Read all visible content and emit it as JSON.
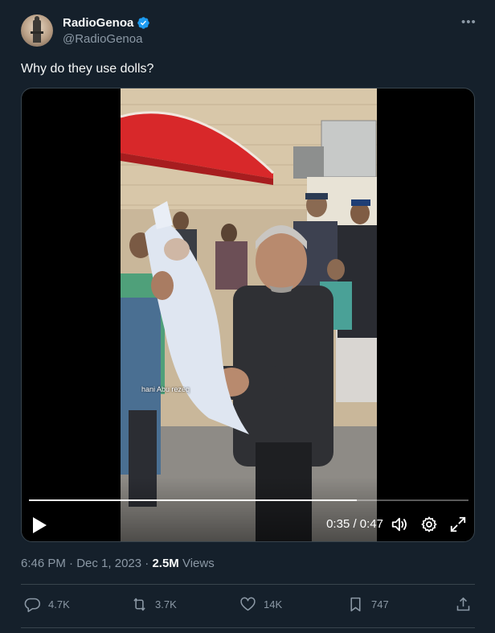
{
  "author": {
    "display_name": "RadioGenoa",
    "handle": "@RadioGenoa",
    "verified": true
  },
  "tweet": {
    "text": "Why do they use dolls?"
  },
  "video": {
    "watermark": "hani Abu rezeq",
    "current_time": "0:35",
    "duration": "0:47",
    "time_display": "0:35 / 0:47",
    "progress_fraction": 0.745
  },
  "meta": {
    "time": "6:46 PM",
    "separator": " · ",
    "date": "Dec 1, 2023",
    "views_count": "2.5M",
    "views_label": " Views"
  },
  "actions": {
    "replies": "4.7K",
    "reposts": "3.7K",
    "likes": "14K",
    "bookmarks": "747"
  },
  "icons": {
    "more": "more-icon",
    "verified": "verified-badge-icon",
    "play": "play-icon",
    "volume": "volume-icon",
    "settings": "settings-gear-icon",
    "fullscreen": "fullscreen-icon",
    "reply": "reply-icon",
    "repost": "repost-icon",
    "like": "like-heart-icon",
    "bookmark": "bookmark-icon",
    "share": "share-icon"
  },
  "colors": {
    "background": "#15202b",
    "text_primary": "#f7f9f9",
    "text_secondary": "#8b98a5",
    "verified_blue": "#1d9bf0",
    "divider": "#38444d"
  }
}
